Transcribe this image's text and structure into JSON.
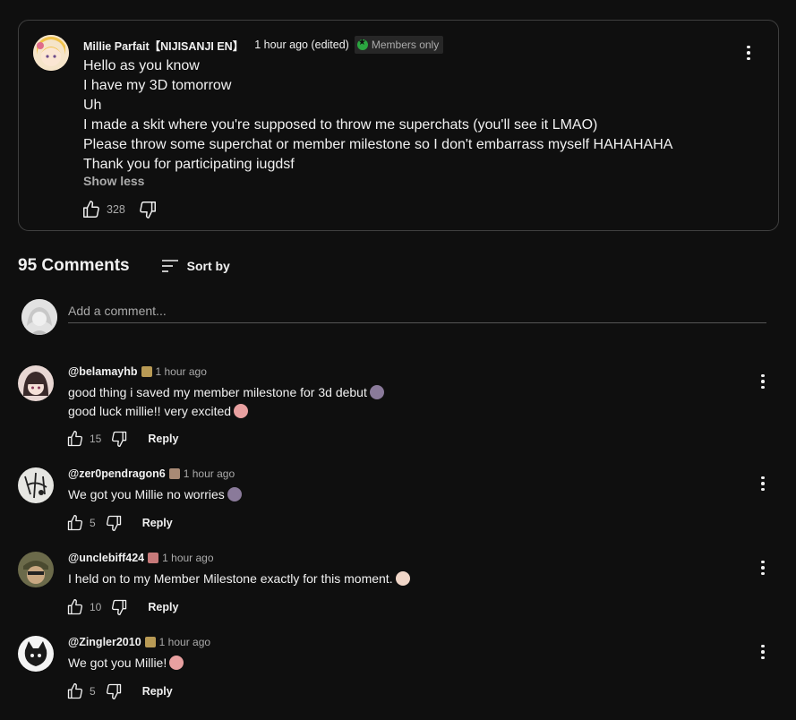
{
  "post": {
    "author": "Millie Parfait【NIJISANJI EN】",
    "time": "1 hour ago (edited)",
    "badge": "Members only",
    "lines": [
      "Hello as you know",
      "I have my 3D tomorrow",
      "Uh",
      "I made a skit where you're supposed to throw me superchats (you'll see it LMAO)",
      "Please throw some superchat or member milestone so I don't embarrass myself HAHAHAHA",
      "Thank you for participating iugdsf"
    ],
    "show_less": "Show less",
    "likes": "328"
  },
  "comments_header": {
    "count": "95 Comments",
    "sort_label": "Sort by"
  },
  "add_comment": {
    "placeholder": "Add a comment..."
  },
  "comments": [
    {
      "handle": "@belamayhb",
      "time": "1 hour ago",
      "lines": [
        "good thing i saved my member milestone for 3d debut",
        "good luck millie!! very excited"
      ],
      "likes": "15",
      "reply": "Reply"
    },
    {
      "handle": "@zer0pendragon6",
      "time": "1 hour ago",
      "lines": [
        "We got you Millie no worries"
      ],
      "likes": "5",
      "reply": "Reply"
    },
    {
      "handle": "@unclebiff424",
      "time": "1 hour ago",
      "lines": [
        "I held on to my Member Milestone exactly for this moment."
      ],
      "likes": "10",
      "reply": "Reply"
    },
    {
      "handle": "@Zingler2010",
      "time": "1 hour ago",
      "lines": [
        "We got you Millie!"
      ],
      "likes": "5",
      "reply": "Reply"
    }
  ],
  "colors": {
    "background": "#0f0f0f",
    "text_primary": "#f1f1f1",
    "text_secondary": "#aaaaaa",
    "members_green": "#2ba640",
    "card_border": "#3f3f3f"
  },
  "icons": [
    "thumbs-up-icon",
    "thumbs-down-icon",
    "more-vert-icon",
    "sort-icon",
    "member-badge-icon",
    "emoji-icon"
  ]
}
